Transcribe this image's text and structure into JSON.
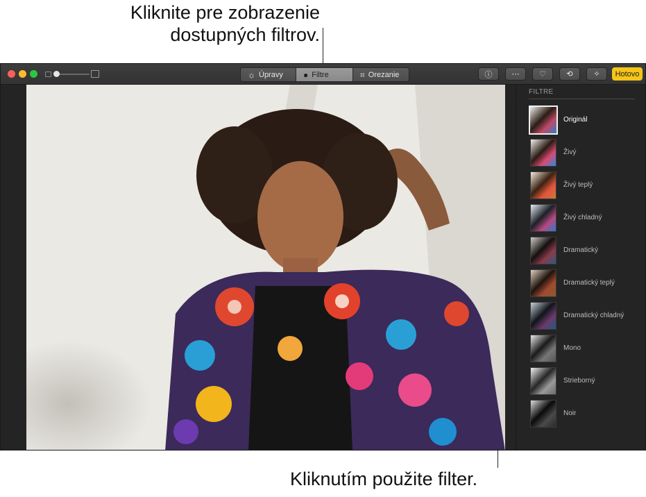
{
  "callouts": {
    "top_line1": "Kliknite pre zobrazenie",
    "top_line2": "dostupných filtrov.",
    "bottom": "Kliknutím použite filter."
  },
  "toolbar": {
    "tabs": [
      {
        "label": "Úpravy",
        "icon": "adjust-sun-icon",
        "active": false
      },
      {
        "label": "Filtre",
        "icon": "filters-circles-icon",
        "active": true
      },
      {
        "label": "Orezanie",
        "icon": "crop-icon",
        "active": false
      }
    ],
    "tools": [
      {
        "name": "info-button",
        "icon": "info-icon",
        "glyph": "ⓘ"
      },
      {
        "name": "more-button",
        "icon": "ellipsis-icon",
        "glyph": "⋯"
      },
      {
        "name": "favorite-button",
        "icon": "heart-icon",
        "glyph": "♡"
      },
      {
        "name": "rotate-button",
        "icon": "rotate-icon",
        "glyph": "⟲"
      },
      {
        "name": "auto-enhance-button",
        "icon": "magic-wand-icon",
        "glyph": "✧"
      }
    ],
    "done_label": "Hotovo",
    "done_color": "#f5c518"
  },
  "sidebar": {
    "title": "FILTRE",
    "filters": [
      {
        "label": "Originál",
        "selected": true,
        "tone": "color"
      },
      {
        "label": "Živý",
        "selected": false,
        "tone": "vivid"
      },
      {
        "label": "Živý teplý",
        "selected": false,
        "tone": "warm"
      },
      {
        "label": "Živý chladný",
        "selected": false,
        "tone": "cool"
      },
      {
        "label": "Dramatický",
        "selected": false,
        "tone": "dramatic"
      },
      {
        "label": "Dramatický teplý",
        "selected": false,
        "tone": "dramatic-warm"
      },
      {
        "label": "Dramatický chladný",
        "selected": false,
        "tone": "dramatic-cool"
      },
      {
        "label": "Mono",
        "selected": false,
        "tone": "mono"
      },
      {
        "label": "Strieborný",
        "selected": false,
        "tone": "silver"
      },
      {
        "label": "Noir",
        "selected": false,
        "tone": "noir"
      }
    ]
  }
}
